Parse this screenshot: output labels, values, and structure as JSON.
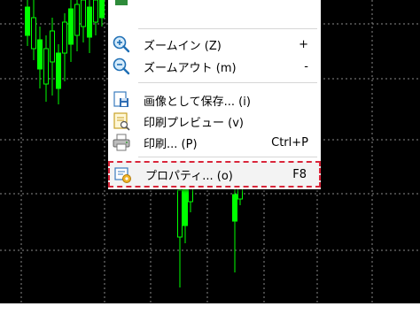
{
  "context_menu": {
    "items": [
      {
        "id": "partial",
        "label": "",
        "shortcut": "",
        "icon": "partial-icon"
      },
      {
        "id": "zoom-in",
        "label": "ズームイン (Z)",
        "shortcut": "+",
        "icon": "zoom-in-icon"
      },
      {
        "id": "zoom-out",
        "label": "ズームアウト (m)",
        "shortcut": "-",
        "icon": "zoom-out-icon"
      },
      {
        "id": "save-as-picture",
        "label": "画像として保存... (i)",
        "shortcut": "",
        "icon": "save-picture-icon"
      },
      {
        "id": "print-preview",
        "label": "印刷プレビュー (v)",
        "shortcut": "",
        "icon": "print-preview-icon"
      },
      {
        "id": "print",
        "label": "印刷... (P)",
        "shortcut": "Ctrl+P",
        "icon": "printer-icon"
      },
      {
        "id": "properties",
        "label": "プロパティ... (o)",
        "shortcut": "F8",
        "icon": "properties-icon"
      }
    ],
    "highlight_color": "#d9263a"
  },
  "chart": {
    "background": "#000000",
    "grid_color": "#8a8a8a",
    "candle_color": "#00ff00"
  }
}
